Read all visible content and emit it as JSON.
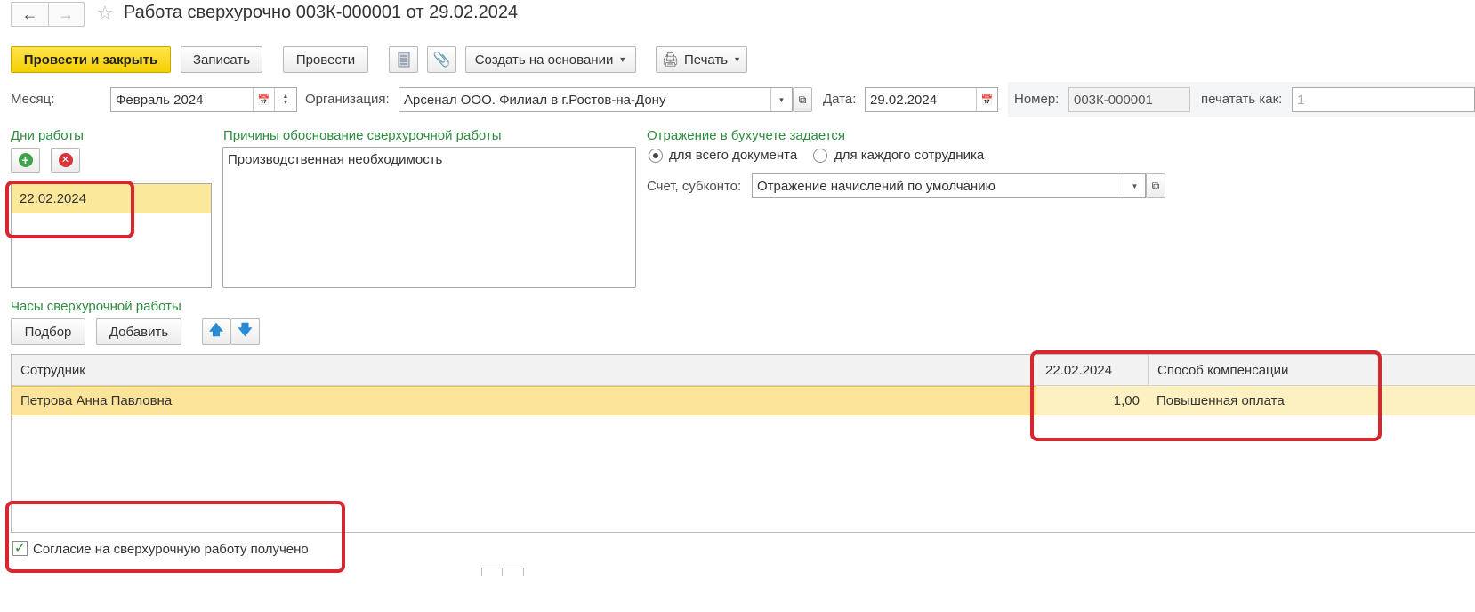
{
  "window": {
    "title": "Работа сверхурочно 003К-000001 от 29.02.2024"
  },
  "toolbar": {
    "post_close": "Провести и закрыть",
    "save": "Записать",
    "post": "Провести",
    "create_based_on": "Создать на основании",
    "print": "Печать"
  },
  "header": {
    "month_label": "Месяц:",
    "month_value": "Февраль 2024",
    "org_label": "Организация:",
    "org_value": "Арсенал ООО. Филиал в г.Ростов-на-Дону",
    "date_label": "Дата:",
    "date_value": "29.02.2024",
    "number_label": "Номер:",
    "number_value": "003К-000001",
    "print_as_label": "печатать как:",
    "print_as_value": "1"
  },
  "work_days": {
    "title": "Дни работы",
    "items": [
      "22.02.2024"
    ]
  },
  "reasons": {
    "title": "Причины обоснование сверхурочной работы",
    "text": "Производственная необходимость"
  },
  "accounting": {
    "title": "Отражение в бухучете задается",
    "option_all": "для всего документа",
    "option_each": "для каждого сотрудника",
    "selected": "option_all",
    "account_label": "Счет, субконто:",
    "account_value": "Отражение начислений по умолчанию"
  },
  "hours": {
    "title": "Часы сверхурочной работы",
    "select_btn": "Подбор",
    "add_btn": "Добавить",
    "columns": {
      "employee": "Сотрудник",
      "date": "22.02.2024",
      "compensation": "Способ компенсации"
    },
    "rows": [
      {
        "employee": "Петрова Анна Павловна",
        "hours": "1,00",
        "compensation": "Повышенная оплата"
      }
    ]
  },
  "consent": {
    "label": "Согласие на сверхурочную работу получено",
    "checked": true
  },
  "colors": {
    "primary_button": "#f5cf00",
    "group_title": "#2e8b3e",
    "selection_row": "#fce89a",
    "annotation": "#d7262d"
  }
}
